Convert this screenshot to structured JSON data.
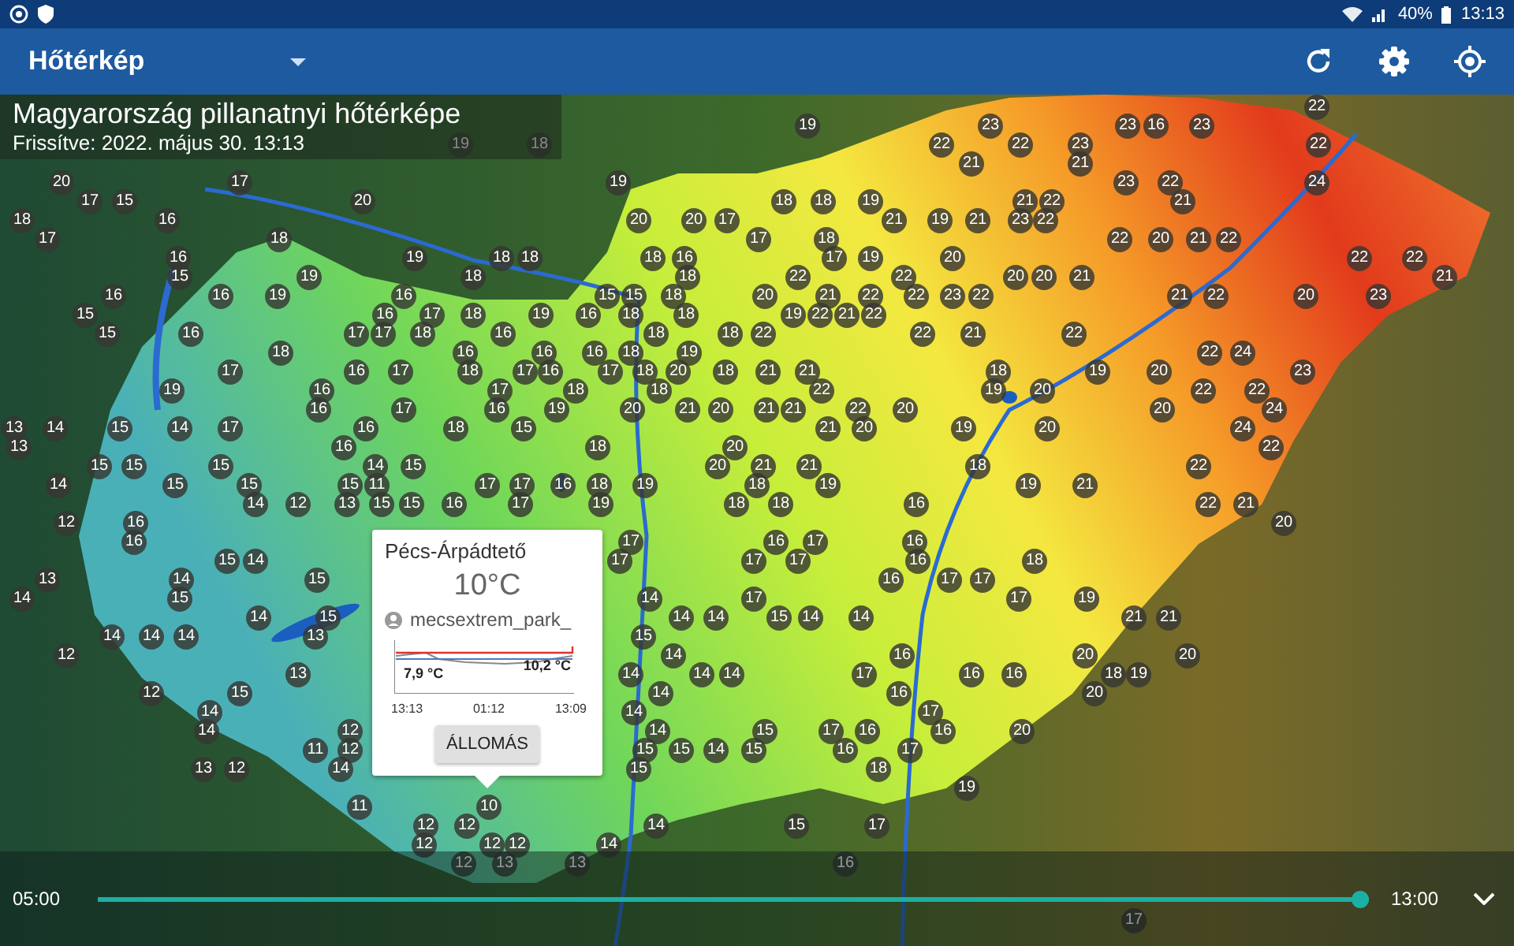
{
  "status_bar": {
    "battery": "40%",
    "time": "13:13"
  },
  "app_bar": {
    "title": "Hőtérkép"
  },
  "map": {
    "title": "Magyarország pillanatnyi hőtérképe",
    "updated": "Frissítve:  2022. május 30. 13:13",
    "markers": [
      "22",
      "19",
      "23",
      "23",
      "16",
      "23",
      "19",
      "18",
      "22",
      "22",
      "23",
      "22",
      "21",
      "21",
      "20",
      "17",
      "19",
      "23",
      "22",
      "24",
      "17",
      "15",
      "20",
      "18",
      "18",
      "19",
      "21",
      "22",
      "21",
      "18",
      "16",
      "20",
      "20",
      "17",
      "21",
      "19",
      "21",
      "23",
      "22",
      "17",
      "18",
      "17",
      "18",
      "22",
      "20",
      "21",
      "22",
      "16",
      "19",
      "18",
      "18",
      "18",
      "16",
      "17",
      "19",
      "20",
      "22",
      "22",
      "15",
      "19",
      "18",
      "18",
      "22",
      "22",
      "20",
      "20",
      "21",
      "21",
      "16",
      "16",
      "19",
      "16",
      "15",
      "15",
      "18",
      "20",
      "21",
      "22",
      "22",
      "23",
      "22",
      "21",
      "22",
      "20",
      "23",
      "15",
      "16",
      "17",
      "18",
      "19",
      "16",
      "18",
      "18",
      "19",
      "22",
      "21",
      "22",
      "15",
      "16",
      "17",
      "17",
      "18",
      "16",
      "18",
      "18",
      "22",
      "22",
      "21",
      "22",
      "18",
      "16",
      "16",
      "16",
      "18",
      "19",
      "22",
      "24",
      "17",
      "16",
      "17",
      "18",
      "17",
      "16",
      "17",
      "18",
      "20",
      "18",
      "21",
      "21",
      "18",
      "19",
      "20",
      "23",
      "19",
      "16",
      "17",
      "18",
      "18",
      "22",
      "19",
      "20",
      "22",
      "22",
      "16",
      "17",
      "16",
      "19",
      "20",
      "21",
      "20",
      "21",
      "21",
      "22",
      "20",
      "20",
      "24",
      "13",
      "14",
      "15",
      "14",
      "17",
      "16",
      "18",
      "15",
      "21",
      "20",
      "19",
      "20",
      "24",
      "13",
      "16",
      "18",
      "20",
      "22",
      "15",
      "15",
      "15",
      "14",
      "15",
      "20",
      "21",
      "21",
      "18",
      "22",
      "14",
      "15",
      "15",
      "15",
      "11",
      "17",
      "17",
      "16",
      "18",
      "19",
      "18",
      "19",
      "19",
      "21",
      "14",
      "12",
      "13",
      "15",
      "15",
      "16",
      "17",
      "19",
      "18",
      "18",
      "16",
      "22",
      "21",
      "12",
      "16",
      "20",
      "16",
      "17",
      "16",
      "17",
      "16",
      "15",
      "14",
      "17",
      "17",
      "17",
      "16",
      "18",
      "13",
      "14",
      "15",
      "16",
      "17",
      "17",
      "14",
      "15",
      "14",
      "17",
      "17",
      "19",
      "14",
      "15",
      "14",
      "14",
      "15",
      "14",
      "14",
      "21",
      "21",
      "14",
      "14",
      "14",
      "13",
      "15",
      "12",
      "14",
      "16",
      "20",
      "20",
      "13",
      "14",
      "14",
      "14",
      "17",
      "16",
      "16",
      "18",
      "19",
      "12",
      "15",
      "14",
      "16",
      "20",
      "14",
      "14",
      "17",
      "14",
      "12",
      "14",
      "15",
      "17",
      "16",
      "16",
      "20",
      "11",
      "12",
      "15",
      "15",
      "14",
      "15",
      "16",
      "17",
      "13",
      "12",
      "14",
      "15",
      "18",
      "19",
      "11",
      "10",
      "12",
      "12",
      "14",
      "15",
      "17",
      "12",
      "12",
      "12",
      "14",
      "12",
      "13",
      "13",
      "16",
      "17"
    ]
  },
  "popup": {
    "station": "Pécs-Árpádtető",
    "temperature": "10°C",
    "user": "mecsextrem_park_",
    "min_label": "7,9 °C",
    "max_label": "10,2 °C",
    "time_labels": [
      "13:13",
      "01:12",
      "13:09"
    ],
    "button": "ÁLLOMÁS"
  },
  "timeline": {
    "start": "05:00",
    "end": "13:00",
    "level": 1
  }
}
